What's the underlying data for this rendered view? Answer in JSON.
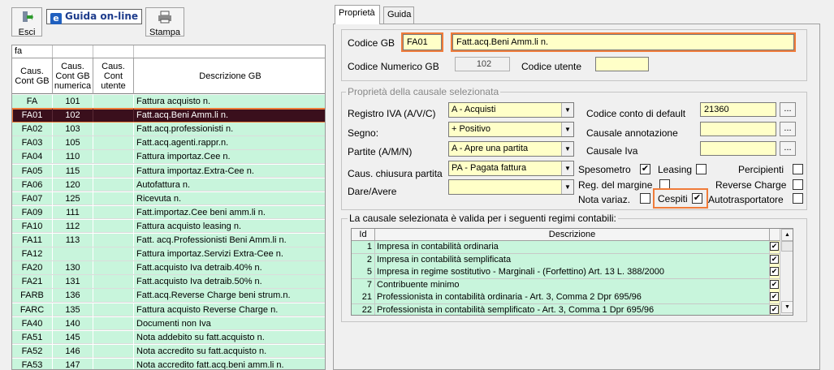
{
  "toolbar": {
    "esci_label": "Esci",
    "guida_label": "Guida on-line",
    "guida_icon": "e",
    "stampa_label": "Stampa"
  },
  "left_grid": {
    "filter_value": "fa",
    "headers": [
      "Caus. Cont GB",
      "Caus. Cont GB numerica",
      "Caus. Cont utente",
      "Descrizione GB"
    ],
    "rows": [
      {
        "code": "FA",
        "num": "101",
        "user": "",
        "desc": "Fattura acquisto n."
      },
      {
        "code": "FA01",
        "num": "102",
        "user": "",
        "desc": "Fatt.acq.Beni Amm.li n.",
        "selected": true
      },
      {
        "code": "FA02",
        "num": "103",
        "user": "",
        "desc": "Fatt.acq.professionisti n."
      },
      {
        "code": "FA03",
        "num": "105",
        "user": "",
        "desc": "Fatt.acq.agenti.rappr.n."
      },
      {
        "code": "FA04",
        "num": "110",
        "user": "",
        "desc": "Fattura importaz.Cee n."
      },
      {
        "code": "FA05",
        "num": "115",
        "user": "",
        "desc": "Fattura importaz.Extra-Cee n."
      },
      {
        "code": "FA06",
        "num": "120",
        "user": "",
        "desc": "Autofattura n."
      },
      {
        "code": "FA07",
        "num": "125",
        "user": "",
        "desc": "Ricevuta n."
      },
      {
        "code": "FA09",
        "num": "111",
        "user": "",
        "desc": "Fatt.importaz.Cee beni amm.li n."
      },
      {
        "code": "FA10",
        "num": "112",
        "user": "",
        "desc": "Fattura acquisto leasing n."
      },
      {
        "code": "FA11",
        "num": "113",
        "user": "",
        "desc": "Fatt. acq.Professionisti Beni Amm.li n."
      },
      {
        "code": "FA12",
        "num": "",
        "user": "",
        "desc": "Fattura importaz.Servizi Extra-Cee n."
      },
      {
        "code": "FA20",
        "num": "130",
        "user": "",
        "desc": "Fatt.acquisto Iva detraib.40% n."
      },
      {
        "code": "FA21",
        "num": "131",
        "user": "",
        "desc": "Fatt.acquisto Iva detraib.50% n."
      },
      {
        "code": "FARB",
        "num": "136",
        "user": "",
        "desc": "Fatt.acq.Reverse Charge beni strum.n."
      },
      {
        "code": "FARC",
        "num": "135",
        "user": "",
        "desc": "Fattura acquisto Reverse Charge n."
      },
      {
        "code": "FA40",
        "num": "140",
        "user": "",
        "desc": "Documenti non Iva"
      },
      {
        "code": "FA51",
        "num": "145",
        "user": "",
        "desc": "Nota addebito su fatt.acquisto n."
      },
      {
        "code": "FA52",
        "num": "146",
        "user": "",
        "desc": "Nota accredito su fatt.acquisto n."
      },
      {
        "code": "FA53",
        "num": "147",
        "user": "",
        "desc": "Nota accredito fatt.acq.beni amm.li n."
      }
    ]
  },
  "tabs": [
    "Proprietà",
    "Guida"
  ],
  "props": {
    "codice_gb_label": "Codice GB",
    "codice_gb_value": "FA01",
    "descrizione_value": "Fatt.acq.Beni Amm.li n.",
    "codice_numerico_label": "Codice Numerico GB",
    "codice_numerico_value": "102",
    "codice_utente_label": "Codice utente",
    "codice_utente_value": ""
  },
  "causale": {
    "legend": "Proprietà della causale selezionata",
    "registro_label": "Registro IVA (A/V/C)",
    "registro_value": "A - Acquisti",
    "segno_label": "Segno:",
    "segno_value": "+ Positivo",
    "partite_label": "Partite (A/M/N)",
    "partite_value": "A - Apre una partita",
    "chiusura_label": "Caus. chiusura partita",
    "chiusura_value": "PA - Pagata fattura",
    "dare_label": "Dare/Avere",
    "dare_value": "",
    "conto_default_label": "Codice conto di default",
    "conto_default_value": "21360",
    "annotazione_label": "Causale annotazione",
    "annotazione_value": "",
    "iva_label": "Causale Iva",
    "iva_value": "",
    "dots": "...",
    "spesometro_label": "Spesometro",
    "leasing_label": "Leasing",
    "percipienti_label": "Percipienti",
    "reg_margine_label": "Reg. del margine",
    "reverse_label": "Reverse Charge",
    "nota_variaz_label": "Nota variaz.",
    "cespiti_label": "Cespiti",
    "autotrasp_label": "Autotrasportatore",
    "check_mark": "✔"
  },
  "regimi": {
    "legend": "La causale selezionata è valida per i seguenti regimi contabili:",
    "headers": [
      "Id",
      "Descrizione"
    ],
    "rows": [
      {
        "id": "1",
        "desc": "Impresa  in contabilità ordinaria"
      },
      {
        "id": "2",
        "desc": "Impresa  in contabilità semplificata"
      },
      {
        "id": "5",
        "desc": "Impresa in regime sostitutivo - Marginali - (Forfettino) Art. 13 L. 388/2000"
      },
      {
        "id": "7",
        "desc": "Contribuente minimo"
      },
      {
        "id": "21",
        "desc": "Professionista in contabilità ordinaria - Art. 3, Comma 2 Dpr 695/96"
      },
      {
        "id": "22",
        "desc": "Professionista in contabilità semplificato - Art. 3, Comma 1 Dpr 695/96"
      }
    ]
  }
}
